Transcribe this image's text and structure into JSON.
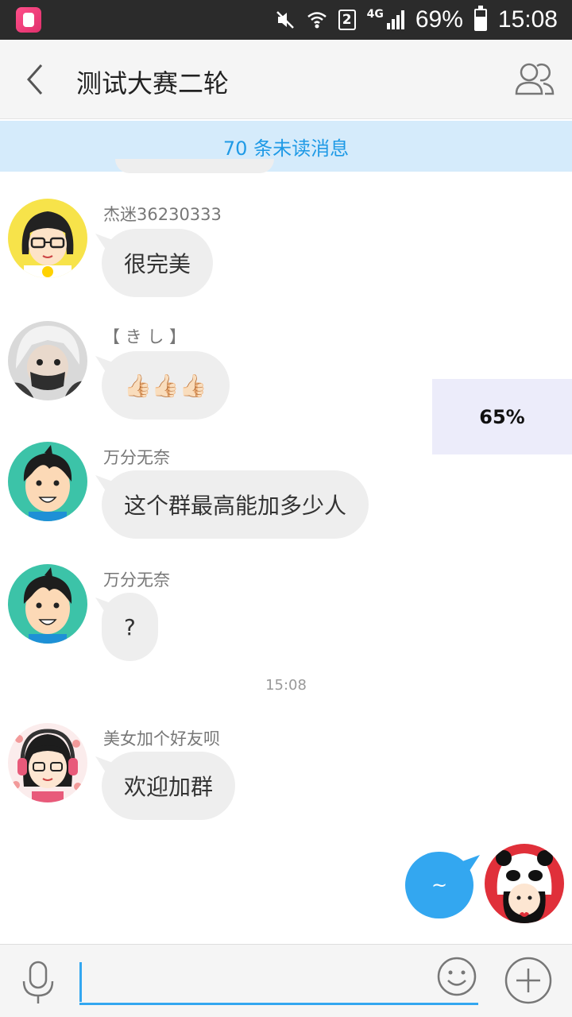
{
  "status_bar": {
    "app_icon": "cartoon-app-icon",
    "icons": [
      "mute-icon",
      "wifi-icon",
      "sim-2-icon",
      "signal-icon",
      "battery-icon"
    ],
    "sim_label": "2",
    "network": "4G",
    "battery": "69%",
    "time": "15:08"
  },
  "header": {
    "title": "测试大赛二轮",
    "back_icon": "chevron-left-icon",
    "members_icon": "group-members-icon"
  },
  "unread_banner": "70 条未读消息",
  "messages": [
    {
      "sender": "杰迷36230333",
      "text": "很完美",
      "avatar": "glasses-girl-avatar"
    },
    {
      "sender": "【 き し 】",
      "text": "👍🏻👍🏻👍🏻",
      "avatar": "white-hair-mask-avatar"
    },
    {
      "sender": "万分无奈",
      "text": "这个群最高能加多少人",
      "avatar": "cartoon-boy-avatar"
    },
    {
      "sender": "万分无奈",
      "text": "?",
      "avatar": "cartoon-boy-avatar"
    },
    {
      "sender": "美女加个好友呗",
      "text": "欢迎加群",
      "avatar": "headphone-girl-avatar"
    }
  ],
  "timestamp": "15:08",
  "my_message": {
    "text": "~",
    "avatar": "panda-hat-girl-avatar"
  },
  "overlay_percent": "65%",
  "input_bar": {
    "placeholder": "",
    "value": "",
    "mic_icon": "microphone-icon",
    "emoji_icon": "smiley-icon",
    "plus_icon": "plus-circle-icon"
  },
  "colors": {
    "accent": "#33a7f0",
    "banner_bg": "#d5ebfb",
    "banner_text": "#1f9ae6",
    "bubble_bg": "#eeeeee",
    "status_bar_bg": "#2b2b2b"
  }
}
